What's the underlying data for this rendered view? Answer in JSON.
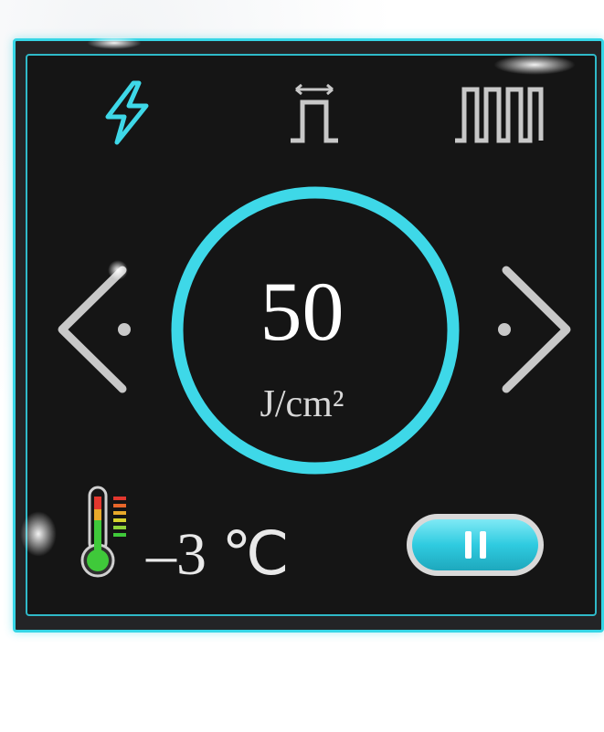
{
  "colors": {
    "accent": "#3ed8e8",
    "icon_inactive": "#c8c8c8",
    "text": "#ffffff",
    "screen_bg": "#151515",
    "thermo_green": "#3fc93a"
  },
  "mode_icons": [
    {
      "icon": "lightning-bolt-icon",
      "active": true
    },
    {
      "icon": "pulse-width-icon",
      "active": false
    },
    {
      "icon": "pulse-train-icon",
      "active": false
    }
  ],
  "energy": {
    "value": "50",
    "unit": "J/cm²"
  },
  "temperature": {
    "value": "–3 ℃",
    "icon": "thermometer-icon"
  },
  "controls": {
    "prev_icon": "chevron-left-icon",
    "next_icon": "chevron-right-icon",
    "pause_icon": "pause-icon"
  }
}
